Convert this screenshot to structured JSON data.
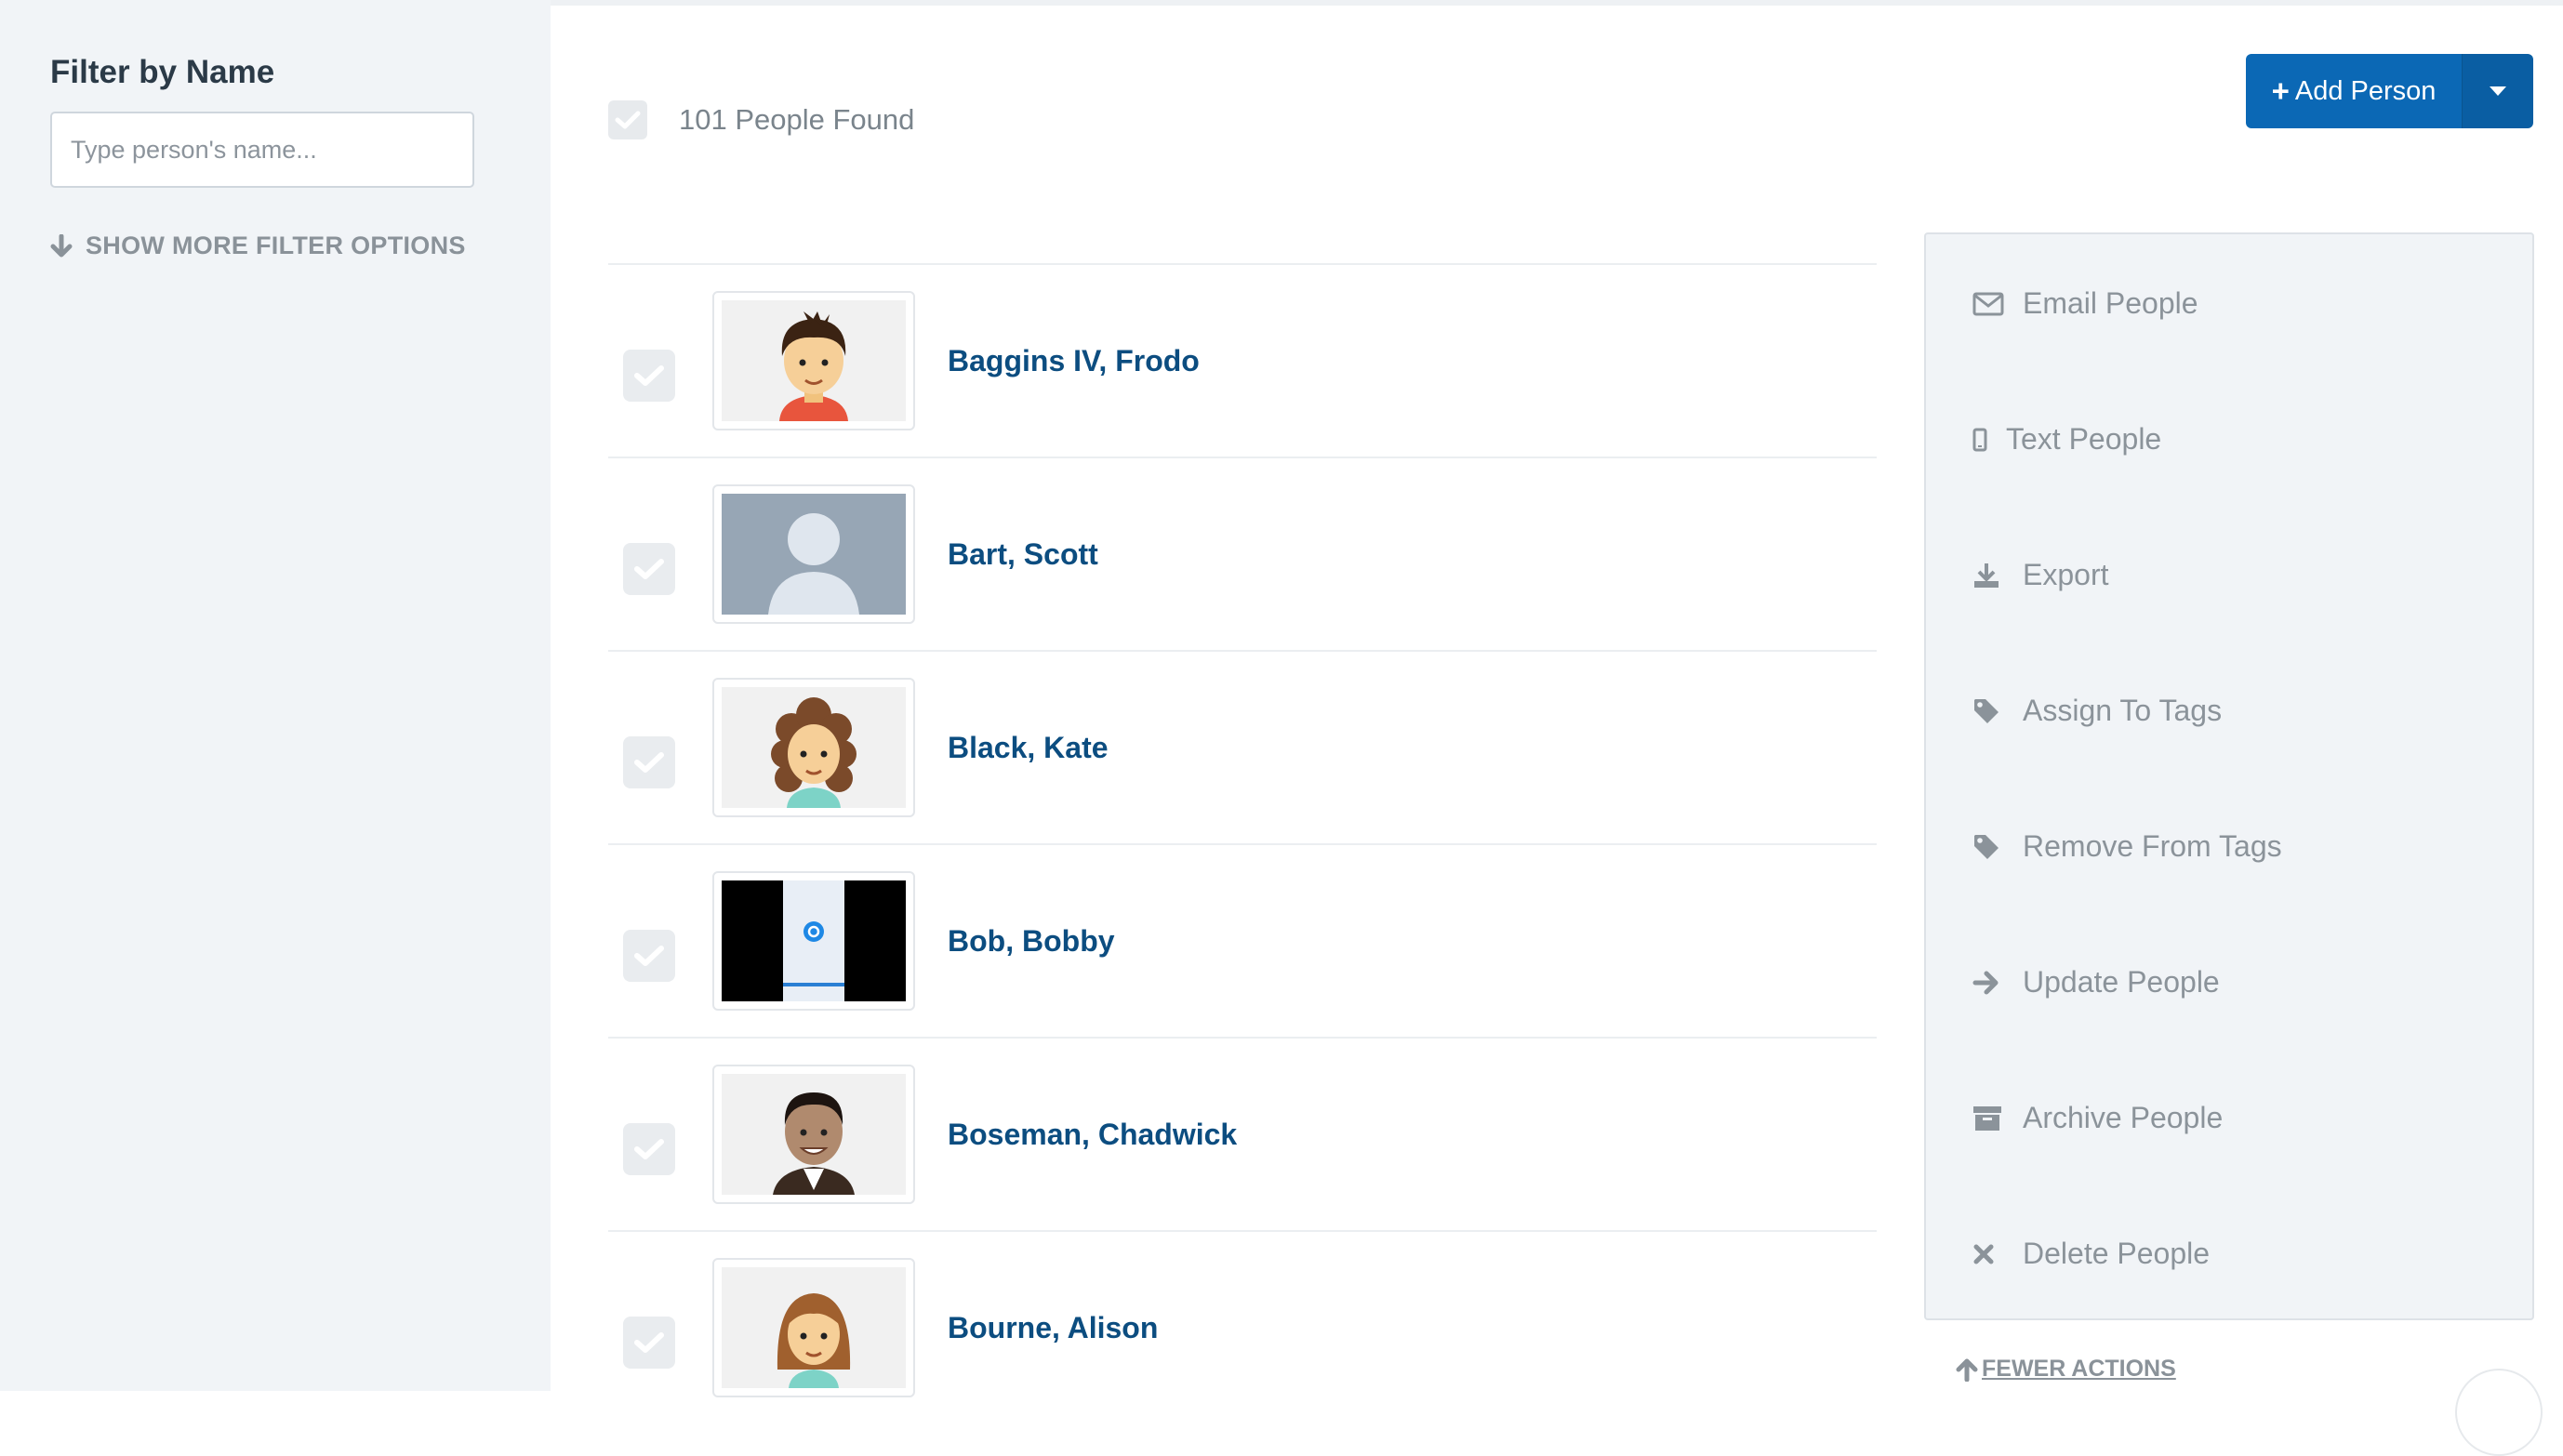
{
  "sidebar": {
    "title": "Filter by Name",
    "search_placeholder": "Type person's name...",
    "more_filters_label": "SHOW MORE FILTER OPTIONS"
  },
  "header": {
    "people_found": "101 People Found",
    "add_person_label": "Add Person"
  },
  "people": [
    {
      "name": "Baggins IV, Frodo"
    },
    {
      "name": "Bart, Scott"
    },
    {
      "name": "Black, Kate"
    },
    {
      "name": "Bob, Bobby"
    },
    {
      "name": "Boseman, Chadwick"
    },
    {
      "name": "Bourne, Alison"
    }
  ],
  "actions": [
    {
      "label": "Email People",
      "icon": "envelope-icon"
    },
    {
      "label": "Text People",
      "icon": "phone-icon"
    },
    {
      "label": "Export",
      "icon": "download-icon"
    },
    {
      "label": "Assign To Tags",
      "icon": "tag-icon"
    },
    {
      "label": "Remove From Tags",
      "icon": "tag-icon"
    },
    {
      "label": "Update People",
      "icon": "arrow-right-icon"
    },
    {
      "label": "Archive People",
      "icon": "archive-icon"
    },
    {
      "label": "Delete People",
      "icon": "close-icon"
    }
  ],
  "fewer_actions_label": "FEWER ACTIONS",
  "colors": {
    "primary": "#0b68b5",
    "name_link": "#0c4d80",
    "sidebar_bg": "#f1f4f7"
  }
}
